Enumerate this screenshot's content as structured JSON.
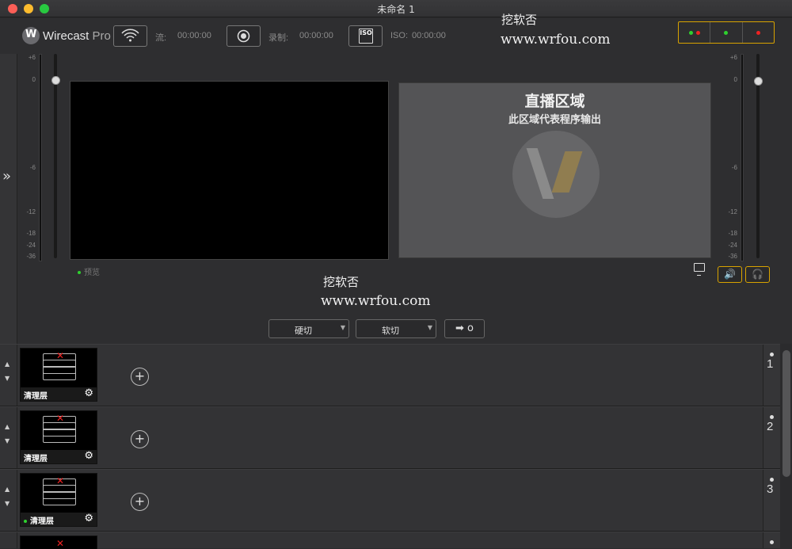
{
  "window": {
    "title": "未命名 1"
  },
  "brand": {
    "name": "Wirecast",
    "edition": "Pro"
  },
  "toolbar": {
    "stream_label": "流:",
    "stream_time": "00:00:00",
    "record_label": "录制:",
    "record_time": "00:00:00",
    "iso_badge": "ISO",
    "iso_label": "ISO:",
    "iso_time": "00:00:00"
  },
  "meters": {
    "left_scale": [
      "+6",
      "0",
      "-6",
      "-12",
      "-18",
      "-24",
      "-36"
    ],
    "right_scale": [
      "+6",
      "0",
      "-6",
      "-12",
      "-18",
      "-24",
      "-36"
    ]
  },
  "preview": {
    "label": "预览"
  },
  "live": {
    "title": "直播区域",
    "subtitle": "此区域代表程序输出"
  },
  "watermark": {
    "line1": "挖软否",
    "line2": "www.wrfou.com"
  },
  "transitions": {
    "cut_label": "硬切",
    "smooth_label": "软切",
    "go_label": "➡ o"
  },
  "layers": [
    {
      "number": "1",
      "name": "清理层",
      "active": false
    },
    {
      "number": "2",
      "name": "清理层",
      "active": false
    },
    {
      "number": "3",
      "name": "清理层",
      "active": true
    }
  ],
  "colors": {
    "accent": "#d8a300",
    "green": "#2ed12e",
    "red": "#e22222"
  }
}
